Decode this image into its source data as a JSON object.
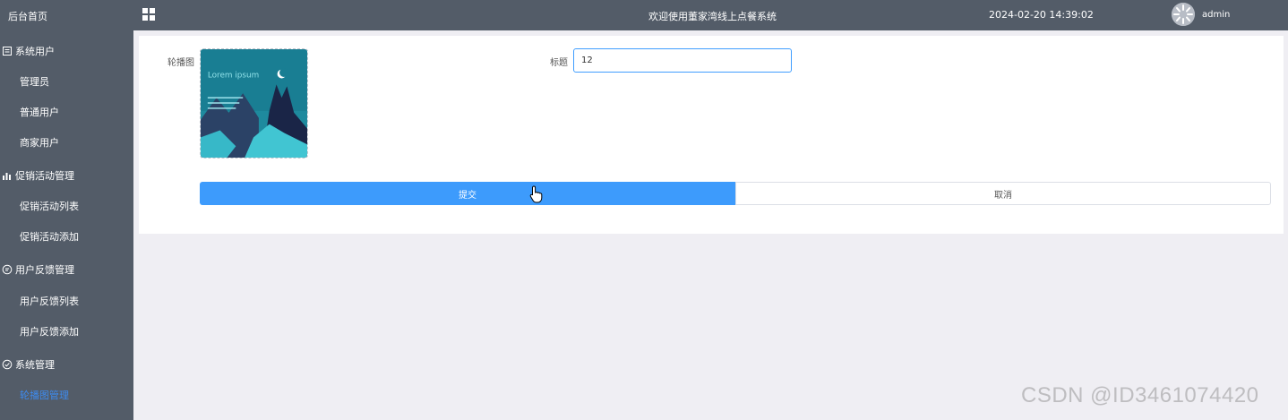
{
  "sidebar": {
    "home": "后台首页",
    "items": [
      {
        "label": "系统用户",
        "type": "group",
        "icon": "list-icon"
      },
      {
        "label": "管理员",
        "type": "child"
      },
      {
        "label": "普通用户",
        "type": "child"
      },
      {
        "label": "商家用户",
        "type": "child"
      },
      {
        "label": "促销活动管理",
        "type": "group",
        "icon": "bar-chart-icon"
      },
      {
        "label": "促销活动列表",
        "type": "child"
      },
      {
        "label": "促销活动添加",
        "type": "child"
      },
      {
        "label": "用户反馈管理",
        "type": "group",
        "icon": "chat-icon"
      },
      {
        "label": "用户反馈列表",
        "type": "child"
      },
      {
        "label": "用户反馈添加",
        "type": "child"
      },
      {
        "label": "系统管理",
        "type": "group",
        "icon": "check-circle-icon"
      },
      {
        "label": "轮播图管理",
        "type": "child",
        "active": true
      }
    ]
  },
  "header": {
    "welcome": "欢迎使用董家湾线上点餐系统",
    "datetime": "2024-02-20 14:39:02",
    "username": "admin"
  },
  "form": {
    "banner_label": "轮播图",
    "title_label": "标题",
    "title_value": "12",
    "submit_label": "提交",
    "cancel_label": "取消"
  },
  "banner_image": {
    "caption": "Lorem ipsum"
  },
  "watermark": "CSDN @ID3461074420",
  "colors": {
    "sidebar_bg": "#535c68",
    "accent": "#3d9bfc",
    "active_menu": "#3d8bf0",
    "page_bg": "#efeef3"
  }
}
